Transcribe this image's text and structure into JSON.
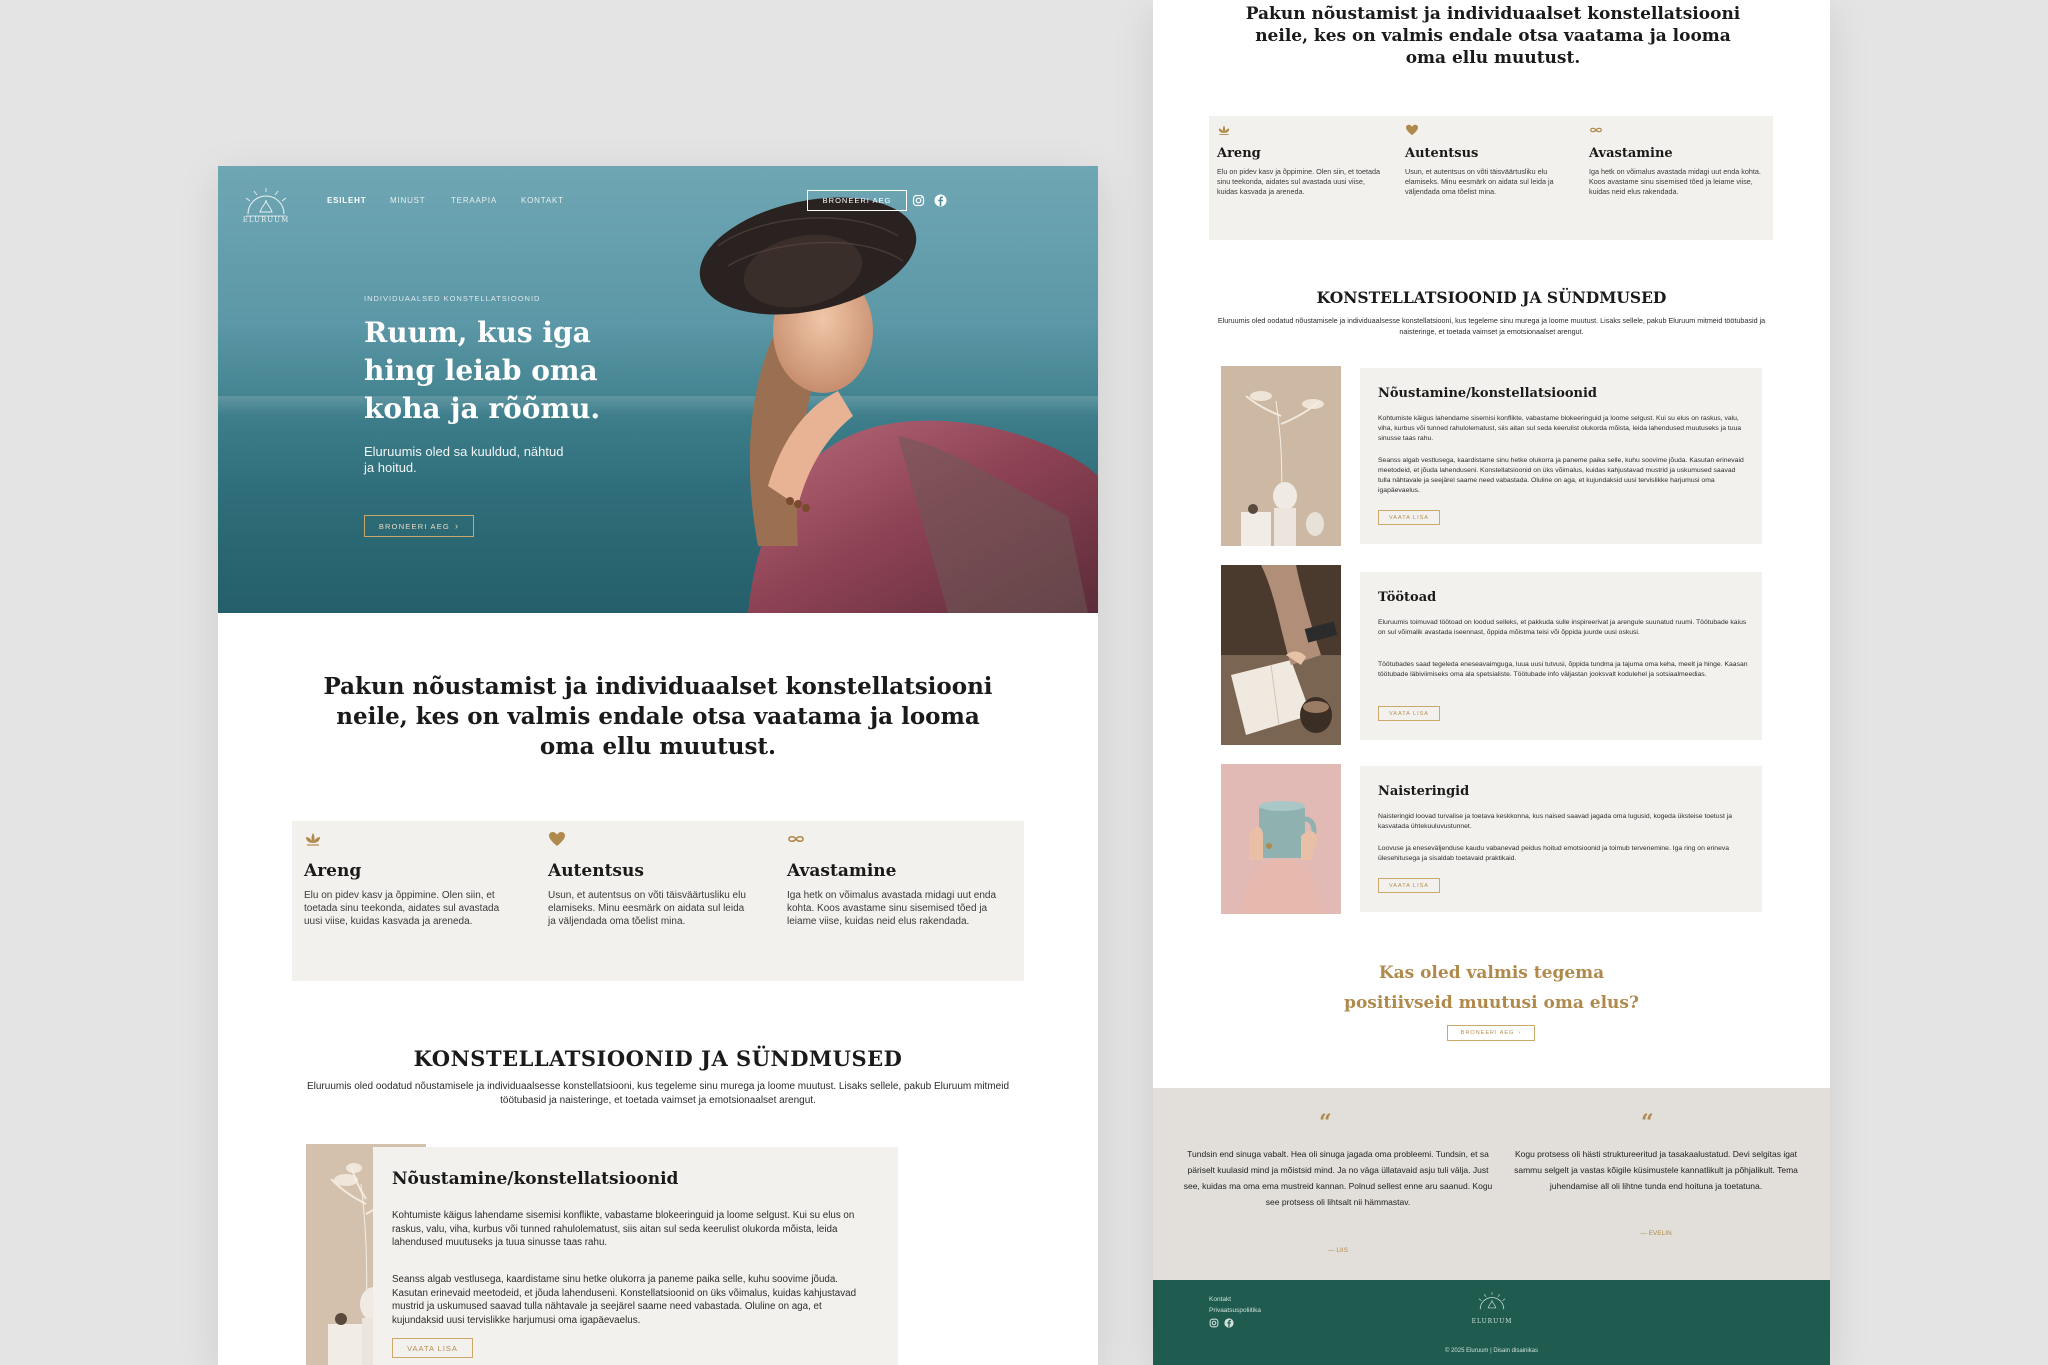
{
  "colors": {
    "background": "#e4e4e4",
    "gold": "#b08a4c",
    "beige_panel": "#f3f1ee",
    "footer_green": "#1f5c4f",
    "testimonial_bg": "#e2dfdb"
  },
  "brand": {
    "logo_text": "ELURUUM"
  },
  "nav": {
    "items": [
      "ESILEHT",
      "MINUST",
      "TERAAPIA",
      "KONTAKT"
    ],
    "cta": "BRONEERI AEG",
    "social_icons": [
      "instagram-icon",
      "facebook-icon"
    ]
  },
  "hero": {
    "eyebrow": "INDIVIDUAALSED KONSTELLATSIOONID",
    "title": "Ruum, kus iga hing leiab oma koha ja rõõmu.",
    "subtitle": "Eluruumis oled sa kuuldud, nähtud ja hoitud.",
    "button": "BRONEERI AEG"
  },
  "intro": "Pakun nõustamist ja individuaalset konstellatsiooni neile, kes on valmis endale otsa vaatama ja looma oma ellu muutust.",
  "values": [
    {
      "icon": "lotus-icon",
      "title": "Areng",
      "text": "Elu on pidev kasv ja õppimine. Olen siin, et toetada sinu teekonda, aidates sul avastada uusi viise, kuidas kasvada ja areneda."
    },
    {
      "icon": "heart-icon",
      "title": "Autentsus",
      "text": "Usun, et autentsus on võti täisväärtusliku elu elamiseks. Minu eesmärk on aidata sul leida ja väljendada oma tõelist mina."
    },
    {
      "icon": "infinity-icon",
      "title": "Avastamine",
      "text": "Iga hetk on võimalus avastada midagi uut enda kohta. Koos avastame sinu sisemised tõed ja leiame viise, kuidas neid elus rakendada."
    }
  ],
  "section": {
    "title": "KONSTELLATSIOONID JA SÜNDMUSED",
    "subtitle": "Eluruumis oled oodatud nõustamisele ja individuaalsesse konstellatsiooni, kus tegeleme sinu murega ja loome muutust. Lisaks sellele, pakub Eluruum mitmeid töötubasid ja naisteringe, et toetada vaimset ja emotsionaalset arengut."
  },
  "services": [
    {
      "title": "Nõustamine/konstellatsioonid",
      "p1": "Kohtumiste käigus lahendame sisemisi konflikte, vabastame blokeeringuid ja loome selgust. Kui su elus on raskus, valu, viha, kurbus või tunned rahulolematust, siis aitan sul seda keerulist olukorda mõista, leida lahendused muutuseks ja tuua sinusse taas rahu.",
      "p2": "Seanss algab vestlusega, kaardistame sinu hetke olukorra ja paneme paika selle, kuhu soovime jõuda. Kasutan erinevaid meetodeid, et jõuda lahenduseni. Konstellatsioonid on üks võimalus, kuidas kahjustavad mustrid ja uskumused saavad tulla nähtavale ja seejärel saame need vabastada. Oluline on aga, et kujundaksid uusi tervislikke harjumusi oma igapäevaelus.",
      "button": "VAATA LISA"
    },
    {
      "title": "Töötoad",
      "p1": "Eluruumis toimuvad töötoad on loodud selleks, et pakkuda sulle inspireerivat ja arengule suunatud ruumi. Töötubade kaius on sul võimalik avastada iseennast, õppida mõistma teisi või õppida juurde uusi oskusi.",
      "p2": "Töötubades saad tegeleda eneseavaimguga, luua uusi tutvusi, õppida tundma ja tajuma oma keha, meelt ja hinge. Kaasan töötubade läbiviimiseks oma ala spetsialiste. Töötubade info väljastan jooksvalt kodulehel ja sotsiaalmeedias.",
      "button": "VAATA LISA"
    },
    {
      "title": "Naisteringid",
      "p1": "Naisteringid loovad turvalise ja toetava keskkonna, kus naised saavad jagada oma lugusid, kogeda üksteise toetust ja kasvatada ühtekuuluvustunnet.",
      "p2": "Loovuse ja eneseväljenduse kaudu vabanevad peidus hoitud emotsioonid ja toimub tervenemine. Iga ring on erineva ülesehitusega ja sisaldab toetavaid praktikaid.",
      "button": "VAATA LISA"
    }
  ],
  "cta": {
    "title": "Kas oled valmis tegema positiivseid muutusi oma elus?",
    "button": "BRONEERI AEG"
  },
  "testimonials": [
    {
      "text": "Tundsin end sinuga vabalt. Hea oli sinuga jagada oma probleemi. Tundsin, et sa päriselt kuulasid mind ja mõistsid mind. Ja no väga üllatavaid asju tuli välja. Just see, kuidas ma oma ema mustreid kannan. Polnud sellest enne aru saanud. Kogu see protsess oli lihtsalt nii hämmastav.",
      "author": "— LIIS"
    },
    {
      "text": "Kogu protsess oli hästi struktureeritud ja tasakaalustatud. Devi selgitas igat sammu selgelt ja vastas kõigile küsimustele kannatlikult ja põhjalikult. Tema juhendamise all oli lihtne tunda end hoituna ja toetatuna.",
      "author": "— EVELIN"
    }
  ],
  "footer": {
    "links": [
      "Kontakt",
      "Privaatsuspoliitika"
    ],
    "logo_text": "ELURUUM",
    "copyright": "© 2025 Eluruum | Disain disainikas"
  }
}
